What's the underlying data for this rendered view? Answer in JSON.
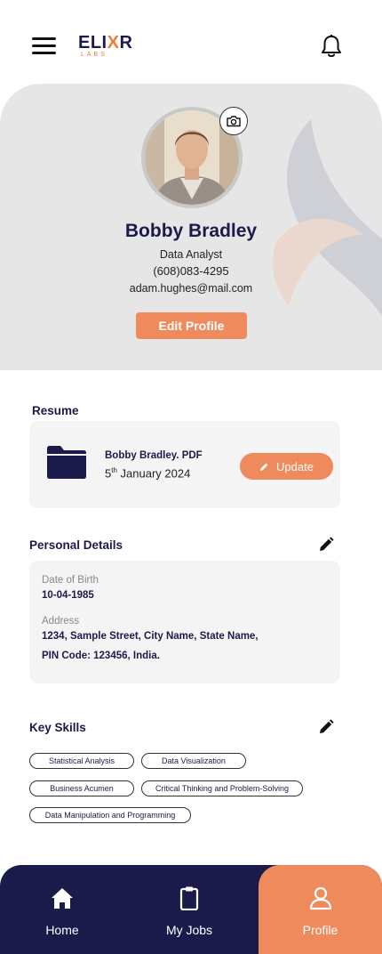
{
  "header": {
    "logo_main": "ELI",
    "logo_x": "X",
    "logo_end": "R",
    "logo_sub": "LABS"
  },
  "profile": {
    "name": "Bobby Bradley",
    "role": "Data Analyst",
    "phone": "(608)083-4295",
    "email": "adam.hughes@mail.com",
    "edit_label": "Edit Profile"
  },
  "resume": {
    "title": "Resume",
    "file_name": "Bobby Bradley. PDF",
    "date_day": "5",
    "date_suffix": "th",
    "date_rest": " January 2024",
    "update_label": "Update"
  },
  "personal": {
    "title": "Personal Details",
    "dob_label": "Date of Birth",
    "dob_value": "10-04-1985",
    "address_label": "Address",
    "address_line1": "1234, Sample Street, City Name, State Name,",
    "address_line2": "PIN Code: 123456, India."
  },
  "skills": {
    "title": "Key Skills",
    "items": [
      "Statistical Analysis",
      "Data Visualization",
      "Business Acumen",
      "Critical Thinking and Problem-Solving",
      "Data Manipulation and Programming"
    ]
  },
  "nav": {
    "home": "Home",
    "jobs": "My Jobs",
    "profile": "Profile"
  },
  "colors": {
    "accent": "#ee8a5c",
    "navy": "#1b1b4b"
  }
}
